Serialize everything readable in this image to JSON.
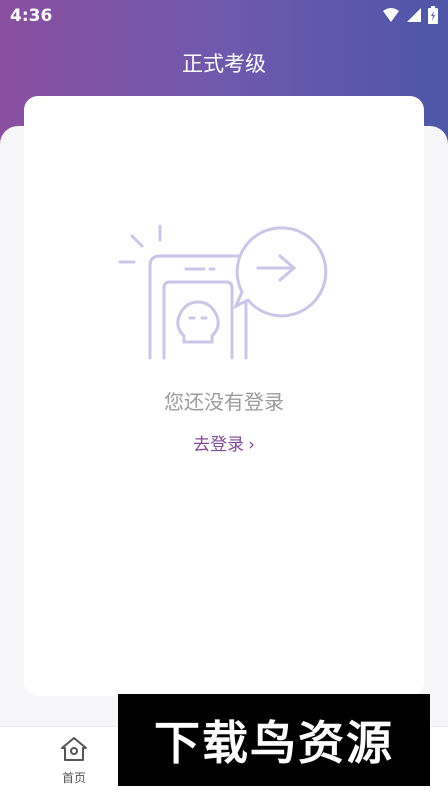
{
  "status_bar": {
    "time": "4:36",
    "icons": [
      "wifi-icon",
      "signal-icon",
      "battery-icon"
    ]
  },
  "header": {
    "title": "正式考级"
  },
  "empty_state": {
    "message": "您还没有登录",
    "login_link": "去登录",
    "login_chevron": "›"
  },
  "bottom_nav": {
    "items": [
      {
        "label": "首页",
        "icon": "home-icon"
      }
    ]
  },
  "watermark": {
    "text": "下载鸟资源"
  },
  "colors": {
    "header_gradient_start": "#8a4f9f",
    "header_gradient_end": "#4e56a8",
    "link": "#7e4b96",
    "illustration": "#c9c6e8"
  }
}
